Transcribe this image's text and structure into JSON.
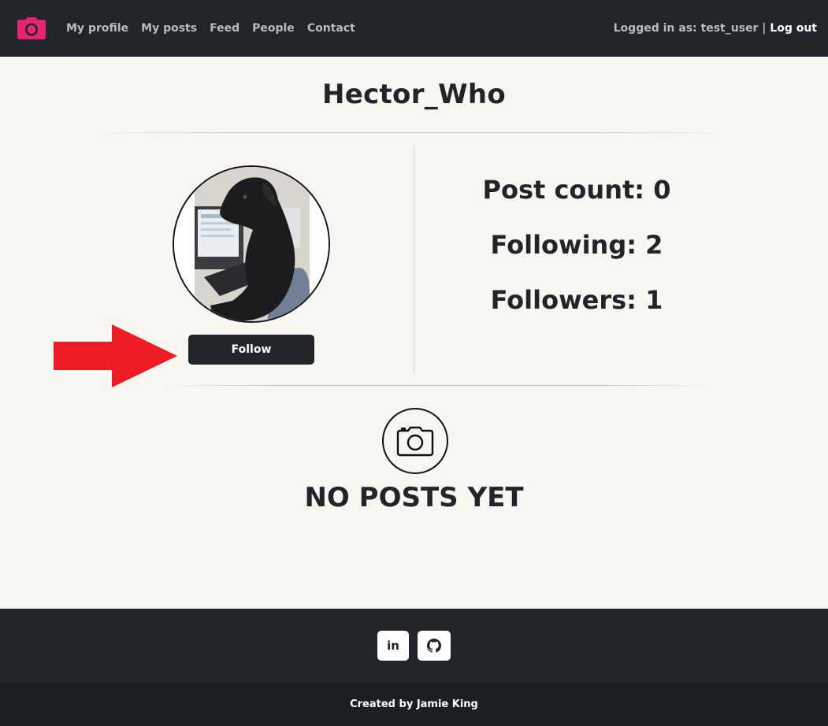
{
  "nav": {
    "brand_icon": "camera-icon",
    "brand_color": "#e5266f",
    "links": [
      "My profile",
      "My posts",
      "Feed",
      "People",
      "Contact"
    ],
    "logged_in_text": "Logged in as: test_user |",
    "logout_label": "Log out"
  },
  "profile": {
    "username": "Hector_Who",
    "follow_label": "Follow",
    "stats": {
      "post_count": "Post count: 0",
      "following": "Following: 2",
      "followers": "Followers: 1"
    },
    "no_posts_text": "NO POSTS YET"
  },
  "annotation": {
    "arrow_color": "#ed1c24"
  },
  "footer": {
    "linkedin_label": "in",
    "github_icon": "github-icon",
    "credit": "Created by Jamie King"
  }
}
